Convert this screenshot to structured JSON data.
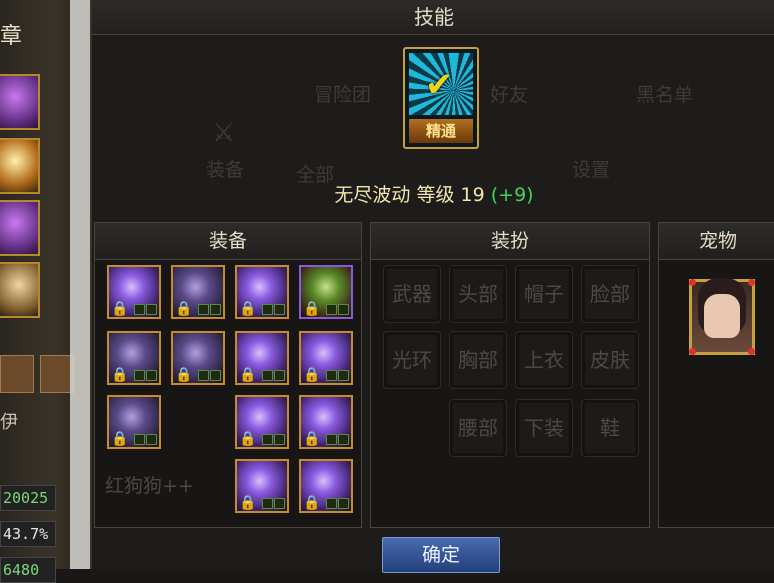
{
  "background": {
    "title_fragment": "章",
    "left_text": "伊",
    "numbers": [
      "20025",
      "43.7%",
      "6480"
    ]
  },
  "dialog": {
    "title": "技能",
    "skill": {
      "rank_label": "精通",
      "name": "无尽波动",
      "level_label": "等级",
      "level": "19",
      "bonus": "(+9)"
    },
    "ghost_text": {
      "adventure_group": "冒险团",
      "friend": "好友",
      "blacklist": "黑名单",
      "equip": "装备",
      "all": "全部",
      "settings": "设置",
      "pet_char": "红狗狗++"
    },
    "equipment": {
      "title": "装备",
      "items": [
        {
          "icon": "armor-shoulder-icon",
          "lock": "blue"
        },
        {
          "icon": "armor-chest-icon",
          "lock": "blue"
        },
        {
          "icon": "dark-spikes-icon",
          "lock": "blue"
        },
        {
          "icon": "tree-icon",
          "lock": "blue"
        },
        {
          "icon": "armor-pants-icon",
          "lock": "blue"
        },
        {
          "icon": "armor-belt-icon",
          "lock": "blue"
        },
        {
          "icon": "purple-ring-icon",
          "lock": "blue"
        },
        {
          "icon": "orb-icon",
          "lock": "blue"
        },
        {
          "icon": "armor-boots-icon",
          "lock": "blue"
        },
        {
          "icon": "purple-gem-icon",
          "lock": "gold"
        },
        {
          "icon": "bracelet-icon",
          "lock": "blue"
        },
        {
          "icon": "purple-jewel-icon",
          "lock": "blue"
        },
        {
          "icon": "crystal-icon",
          "lock": "blue"
        }
      ]
    },
    "outfit": {
      "title": "装扮",
      "slots": [
        "武器",
        "头部",
        "帽子",
        "脸部",
        "光环",
        "胸部",
        "上衣",
        "皮肤",
        "腰部",
        "下装",
        "鞋"
      ]
    },
    "pet": {
      "title": "宠物"
    },
    "confirm_label": "确定"
  },
  "colors": {
    "accent_gold": "#c8a040",
    "bonus_green": "#3fd65a",
    "confirm_blue": "#2d4f92"
  }
}
